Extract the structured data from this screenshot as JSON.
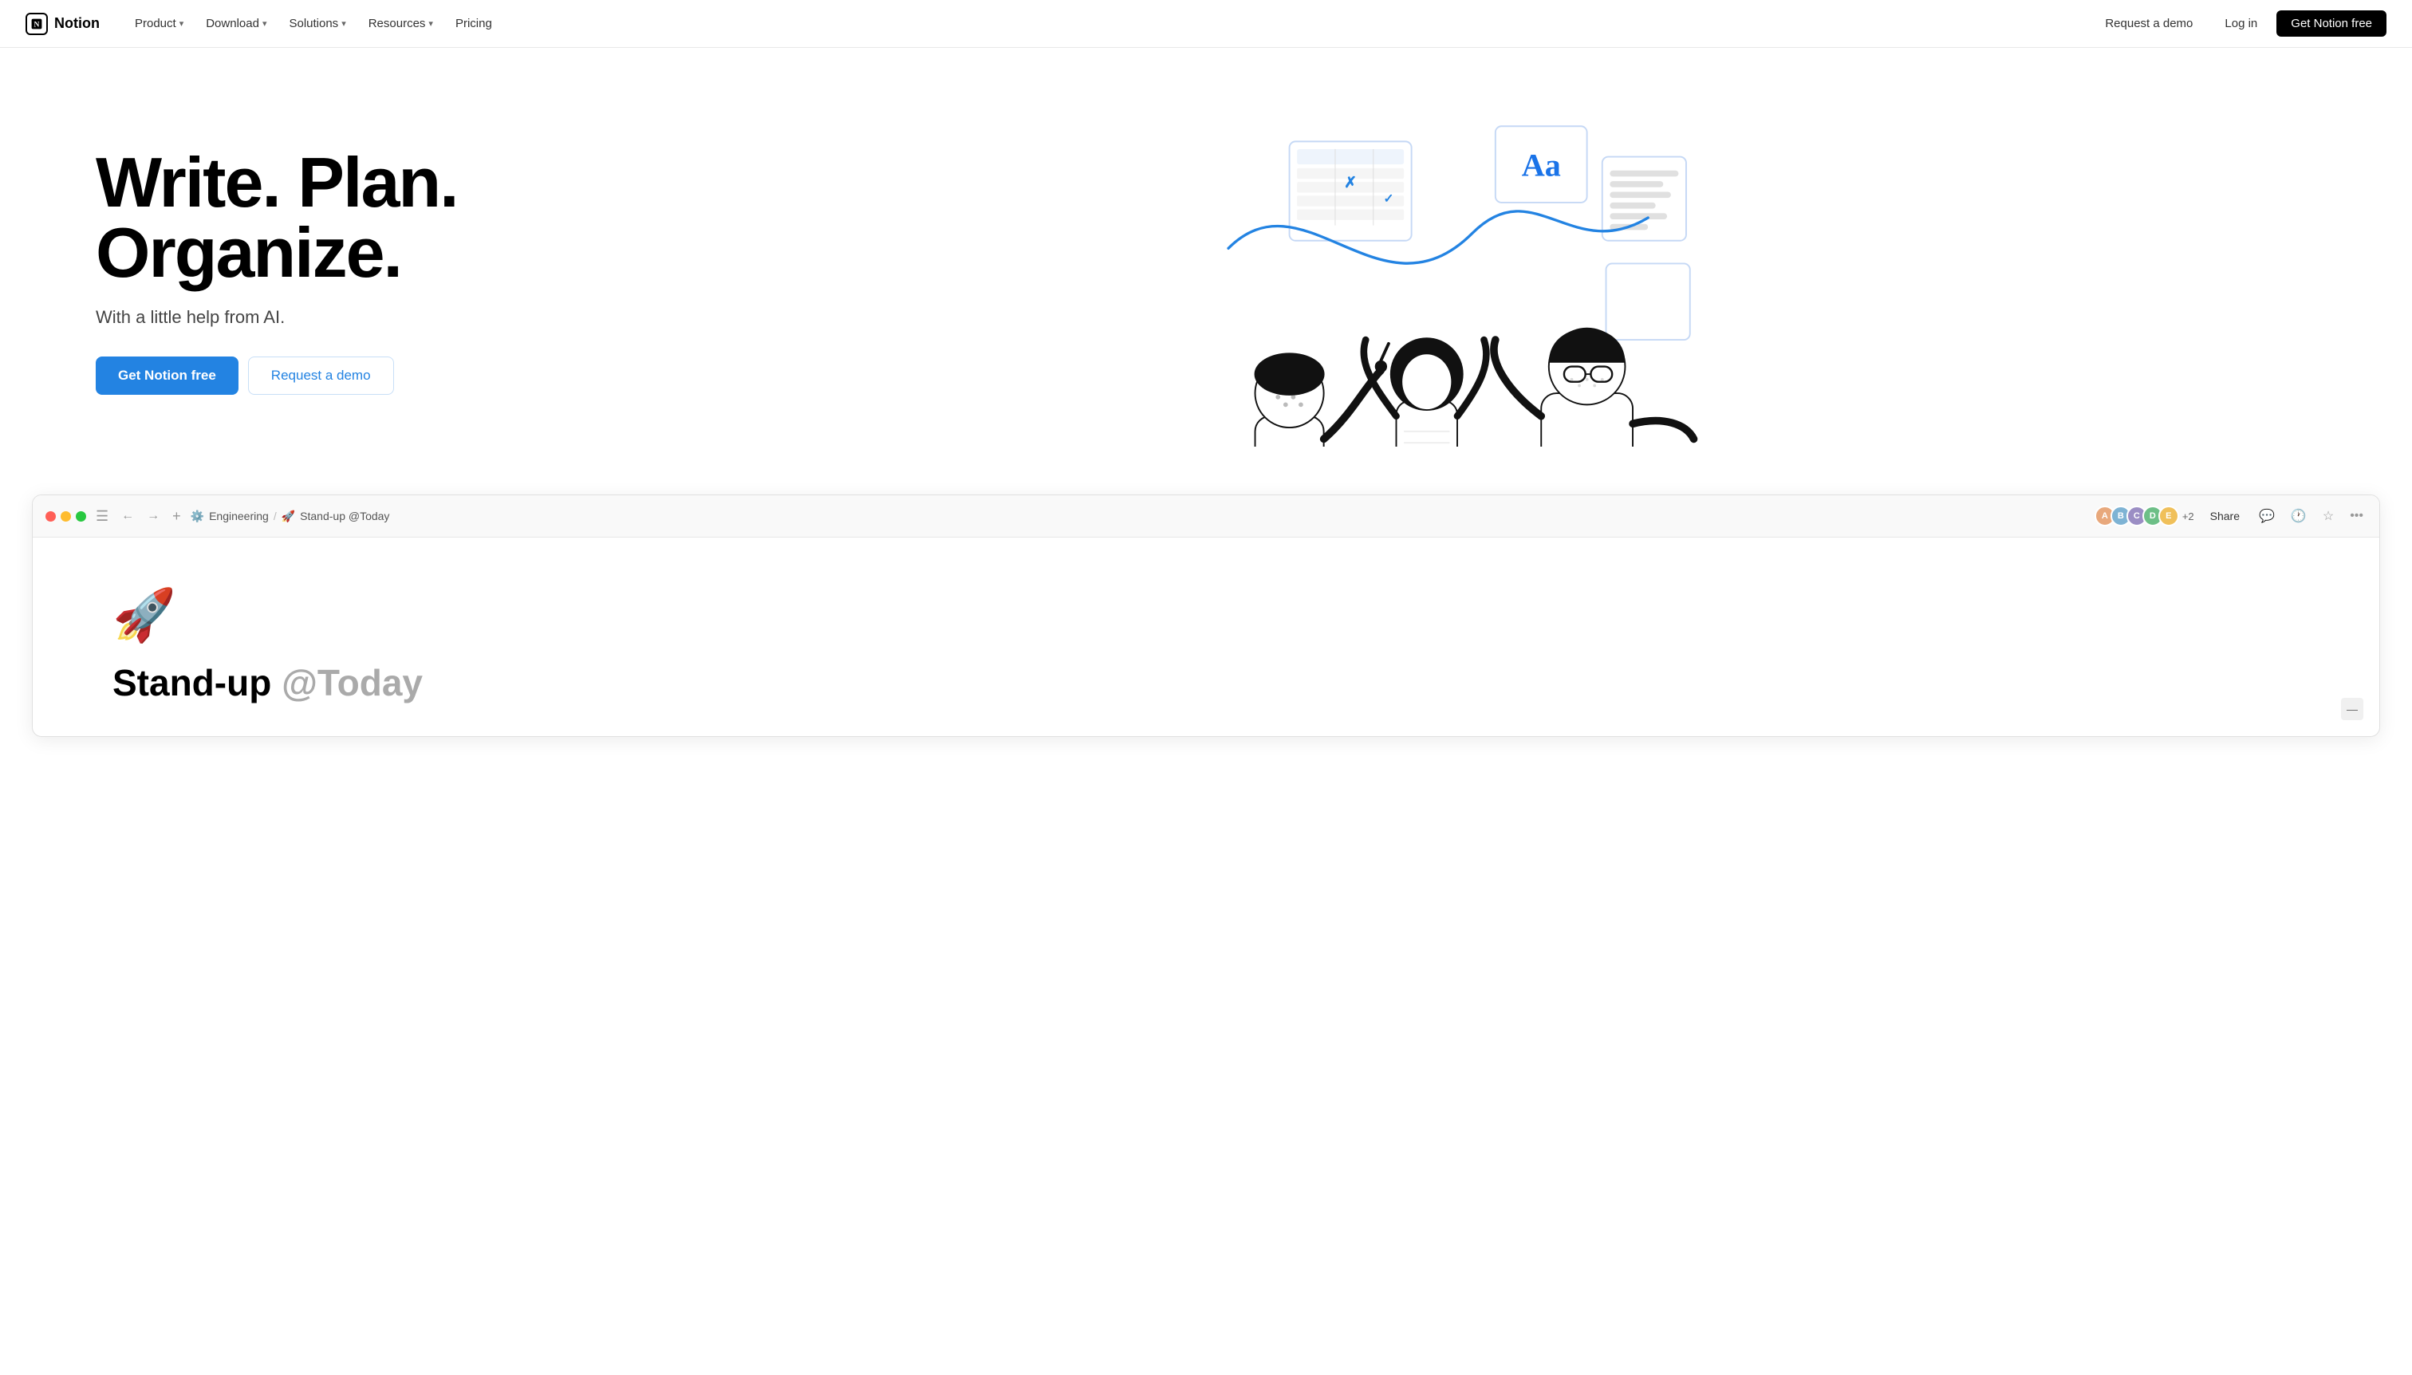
{
  "navbar": {
    "logo_text": "Notion",
    "logo_letter": "N",
    "nav_items": [
      {
        "label": "Product",
        "has_dropdown": true
      },
      {
        "label": "Download",
        "has_dropdown": true
      },
      {
        "label": "Solutions",
        "has_dropdown": true
      },
      {
        "label": "Resources",
        "has_dropdown": true
      },
      {
        "label": "Pricing",
        "has_dropdown": false
      }
    ],
    "request_demo": "Request a demo",
    "login": "Log in",
    "cta": "Get Notion free"
  },
  "hero": {
    "headline_line1": "Write. Plan.",
    "headline_line2": "Organize.",
    "subheading": "With a little help from AI.",
    "btn_primary": "Get Notion free",
    "btn_secondary": "Request a demo"
  },
  "app_preview": {
    "breadcrumb_workspace": "Engineering",
    "breadcrumb_page": "Stand-up @Today",
    "share_label": "Share",
    "avatar_extra": "+2",
    "page_icon": "🚀",
    "page_title": "Stand-up ",
    "page_title_mention": "@Today"
  },
  "colors": {
    "primary_blue": "#2383e2",
    "cta_black": "#000000",
    "avatar1": "#e8a87c",
    "avatar2": "#7eb3d4",
    "avatar3": "#9b8ec4",
    "avatar4": "#6dbf87",
    "avatar5": "#f0c05a"
  }
}
